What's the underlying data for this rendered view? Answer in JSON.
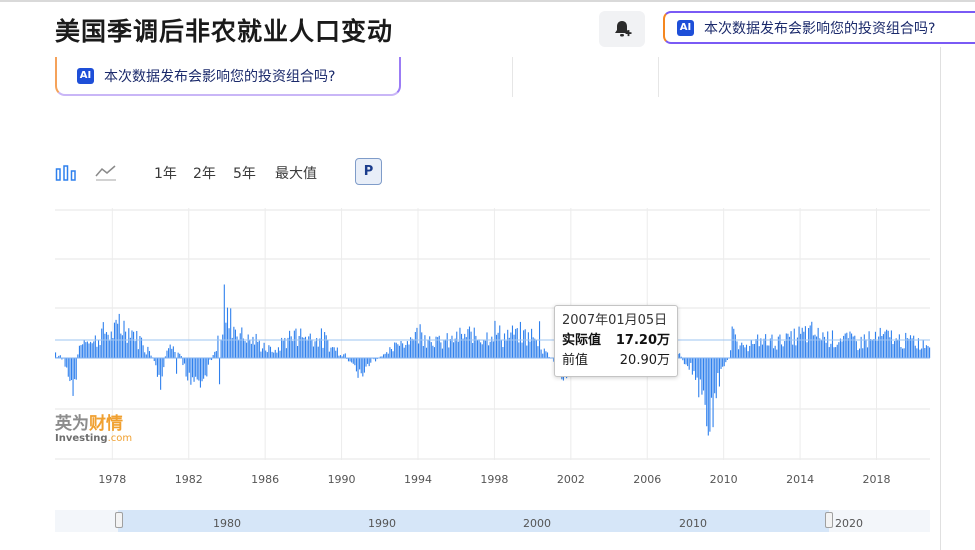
{
  "header": {
    "title": "美国季调后非农就业人口变动",
    "ai_badge": "AI",
    "ai_prompt": "本次数据发布会影响您的投资组合吗?"
  },
  "ai_card": {
    "badge": "AI",
    "text": "本次数据发布会影响您的投资组合吗?"
  },
  "toolbar": {
    "ranges": [
      "1年",
      "2年",
      "5年",
      "最大值"
    ],
    "p_label": "P"
  },
  "tooltip": {
    "date": "2007年01月05日",
    "actual_label": "实际值",
    "actual_value": "17.20万",
    "previous_label": "前值",
    "previous_value": "20.90万"
  },
  "watermark": {
    "cn": "英为财情",
    "cn_plain": "英为",
    "cn_highlight": "财情",
    "en_main": "Investing",
    "en_suffix": ".com"
  },
  "navigator": {
    "labels": [
      "1980",
      "1990",
      "2000",
      "2010",
      "2020"
    ]
  },
  "icons": [
    "bell-plus-icon",
    "bar-chart-icon",
    "line-chart-icon"
  ],
  "colors": {
    "bar": "#2f80ed",
    "accent": "#1e4fd8",
    "grid": "#e6e6e6"
  },
  "chart_data": {
    "type": "bar",
    "x_tick_labels": [
      "1978",
      "1982",
      "1986",
      "1990",
      "1994",
      "1998",
      "2002",
      "2006",
      "2010",
      "2014",
      "2018"
    ],
    "x_range": [
      1975.0,
      2020.8
    ],
    "y_range": [
      -60,
      100
    ],
    "y_unit": "万",
    "grid": true,
    "series": [
      {
        "anchors": [
          [
            1975.0,
            5
          ],
          [
            1975.4,
            -2
          ],
          [
            1975.6,
            -8
          ],
          [
            1975.8,
            -25
          ],
          [
            1976.0,
            -30
          ],
          [
            1976.2,
            10
          ],
          [
            1976.6,
            20
          ],
          [
            1977.0,
            15
          ],
          [
            1977.5,
            25
          ],
          [
            1978.0,
            22
          ],
          [
            1978.5,
            30
          ],
          [
            1979.0,
            25
          ],
          [
            1979.5,
            15
          ],
          [
            1980.0,
            5
          ],
          [
            1980.3,
            -10
          ],
          [
            1980.5,
            -25
          ],
          [
            1980.8,
            5
          ],
          [
            1981.2,
            15
          ],
          [
            1981.5,
            5
          ],
          [
            1981.8,
            -15
          ],
          [
            1982.2,
            -20
          ],
          [
            1982.6,
            -20
          ],
          [
            1982.9,
            -15
          ],
          [
            1983.2,
            2
          ],
          [
            1983.5,
            15
          ],
          [
            1983.8,
            30
          ],
          [
            1984.2,
            35
          ],
          [
            1984.6,
            25
          ],
          [
            1985.0,
            20
          ],
          [
            1985.5,
            15
          ],
          [
            1986.0,
            10
          ],
          [
            1986.5,
            5
          ],
          [
            1987.0,
            18
          ],
          [
            1987.5,
            20
          ],
          [
            1988.0,
            22
          ],
          [
            1988.5,
            20
          ],
          [
            1989.0,
            18
          ],
          [
            1989.5,
            10
          ],
          [
            1990.0,
            5
          ],
          [
            1990.5,
            -5
          ],
          [
            1990.8,
            -15
          ],
          [
            1991.2,
            -12
          ],
          [
            1991.6,
            -2
          ],
          [
            1992.0,
            2
          ],
          [
            1992.5,
            6
          ],
          [
            1993.0,
            14
          ],
          [
            1993.5,
            18
          ],
          [
            1994.0,
            25
          ],
          [
            1994.5,
            22
          ],
          [
            1995.0,
            15
          ],
          [
            1995.5,
            15
          ],
          [
            1996.0,
            20
          ],
          [
            1996.5,
            20
          ],
          [
            1997.0,
            22
          ],
          [
            1997.5,
            22
          ],
          [
            1998.0,
            25
          ],
          [
            1998.5,
            20
          ],
          [
            1999.0,
            22
          ],
          [
            1999.5,
            22
          ],
          [
            2000.0,
            20
          ],
          [
            2000.5,
            8
          ],
          [
            2001.0,
            2
          ],
          [
            2001.4,
            -10
          ],
          [
            2001.8,
            -20
          ],
          [
            2002.2,
            -8
          ],
          [
            2002.6,
            -5
          ],
          [
            2003.0,
            -2
          ],
          [
            2003.4,
            -3
          ],
          [
            2003.8,
            8
          ],
          [
            2004.2,
            18
          ],
          [
            2004.6,
            15
          ],
          [
            2005.0,
            18
          ],
          [
            2005.5,
            18
          ],
          [
            2006.0,
            16
          ],
          [
            2006.5,
            12
          ],
          [
            2007.0,
            12
          ],
          [
            2007.5,
            7
          ],
          [
            2008.0,
            -5
          ],
          [
            2008.4,
            -15
          ],
          [
            2008.8,
            -35
          ],
          [
            2009.2,
            -60
          ],
          [
            2009.6,
            -30
          ],
          [
            2010.0,
            -10
          ],
          [
            2010.3,
            5
          ],
          [
            2010.5,
            20
          ],
          [
            2010.8,
            8
          ],
          [
            2011.2,
            15
          ],
          [
            2011.6,
            12
          ],
          [
            2012.0,
            18
          ],
          [
            2012.5,
            15
          ],
          [
            2013.0,
            18
          ],
          [
            2013.5,
            18
          ],
          [
            2014.0,
            22
          ],
          [
            2014.5,
            24
          ],
          [
            2015.0,
            22
          ],
          [
            2015.5,
            20
          ],
          [
            2016.0,
            18
          ],
          [
            2016.5,
            18
          ],
          [
            2017.0,
            16
          ],
          [
            2017.5,
            18
          ],
          [
            2018.0,
            19
          ],
          [
            2018.5,
            21
          ],
          [
            2019.0,
            17
          ],
          [
            2019.5,
            16
          ],
          [
            2020.0,
            15
          ],
          [
            2020.8,
            12
          ]
        ],
        "spikes": [
          [
            1978.3,
            42
          ],
          [
            1983.8,
            70
          ],
          [
            1984.0,
            48
          ],
          [
            1981.3,
            -15
          ],
          [
            1983.6,
            -25
          ],
          [
            1987.6,
            28
          ],
          [
            2009.1,
            -65
          ],
          [
            2010.4,
            30
          ],
          [
            1996.7,
            30
          ],
          [
            2000.3,
            35
          ]
        ]
      }
    ],
    "tooltip_marker_value": 17.2
  }
}
